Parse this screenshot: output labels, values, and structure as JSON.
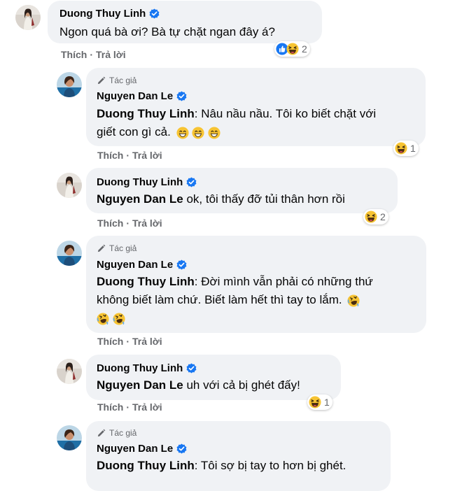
{
  "actions": {
    "like": "Thích",
    "reply": "Trả lời",
    "separator": "·"
  },
  "comments": [
    {
      "author": "Duong Thuy Linh",
      "is_author": false,
      "badge": "",
      "mention": "",
      "text": "Ngon quá bà ơi? Bà tự chặt ngan đây á?",
      "reaction_count": "2"
    },
    {
      "author": "Nguyen Dan Le",
      "is_author": true,
      "badge": "Tác giả",
      "mention": "Duong Thuy Linh",
      "line1": ": Nâu nầu nầu. Tôi ko biết chặt với",
      "line2": "giết con gì cả.",
      "reaction_count": "1"
    },
    {
      "author": "Duong Thuy Linh",
      "is_author": false,
      "badge": "",
      "mention": "Nguyen Dan Le",
      "text": " ok, tôi thấy đỡ tủi thân hơn rồi",
      "reaction_count": "2"
    },
    {
      "author": "Nguyen Dan Le",
      "is_author": true,
      "badge": "Tác giả",
      "mention": "Duong Thuy Linh",
      "line1": ": Đời mình vẫn phải có những thứ",
      "line2": "không biết làm chứ. Biết làm hết thì tay to lắm."
    },
    {
      "author": "Duong Thuy Linh",
      "is_author": false,
      "badge": "",
      "mention": "Nguyen Dan Le",
      "text": " uh với cả bị ghét đấy!",
      "reaction_count": "1"
    },
    {
      "author": "Nguyen Dan Le",
      "is_author": true,
      "badge": "Tác giả",
      "mention": "Duong Thuy Linh",
      "text": ": Tôi sợ bị tay to hơn bị ghét."
    }
  ],
  "colors": {
    "bubble": "#f0f2f5",
    "verified": "#1877f2",
    "like_blue": "#1877f2",
    "emoji_yellow": "#f7c433",
    "muted": "#65676b"
  },
  "icons": {
    "verified": "verified-badge-icon",
    "author": "pen-icon",
    "haha": "haha-reaction-icon",
    "like": "like-reaction-icon",
    "grin": "grinning-emoji-icon",
    "rofl": "rolling-laughing-emoji-icon"
  }
}
